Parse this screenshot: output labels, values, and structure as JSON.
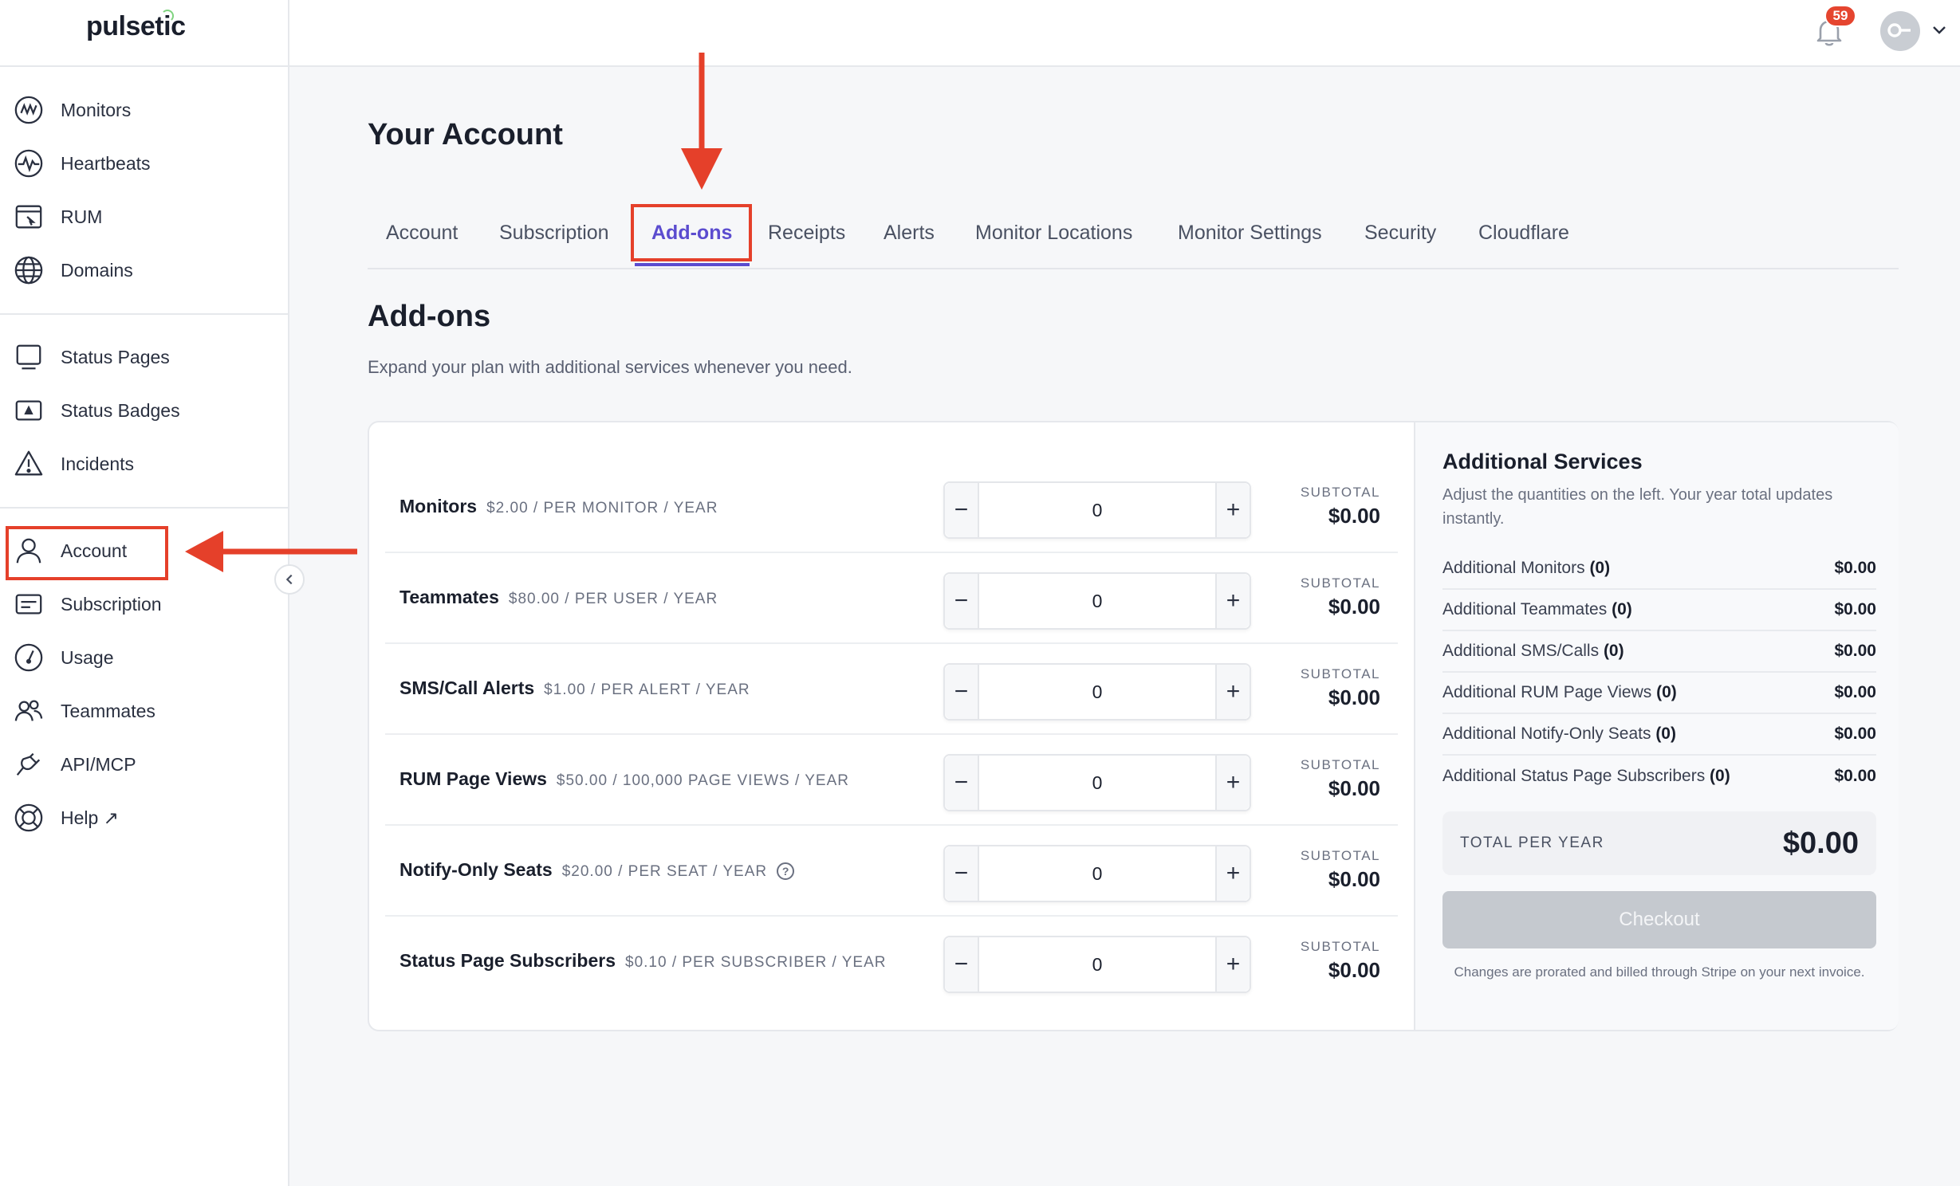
{
  "app": {
    "logo": "pulsetic"
  },
  "header": {
    "notification_count": "59"
  },
  "sidebar": {
    "groups": [
      [
        {
          "label": "Monitors",
          "icon": "monitors-icon"
        },
        {
          "label": "Heartbeats",
          "icon": "heartbeat-icon"
        },
        {
          "label": "RUM",
          "icon": "rum-icon"
        },
        {
          "label": "Domains",
          "icon": "globe-icon"
        }
      ],
      [
        {
          "label": "Status Pages",
          "icon": "status-pages-icon"
        },
        {
          "label": "Status Badges",
          "icon": "status-badges-icon"
        },
        {
          "label": "Incidents",
          "icon": "warning-icon"
        }
      ],
      [
        {
          "label": "Account",
          "icon": "user-icon"
        },
        {
          "label": "Subscription",
          "icon": "card-icon"
        },
        {
          "label": "Usage",
          "icon": "gauge-icon"
        },
        {
          "label": "Teammates",
          "icon": "users-icon"
        },
        {
          "label": "API/MCP",
          "icon": "plug-icon"
        },
        {
          "label": "Help ↗",
          "icon": "lifebuoy-icon"
        }
      ]
    ]
  },
  "page": {
    "title": "Your Account",
    "tabs": [
      "Account",
      "Subscription",
      "Add-ons",
      "Receipts",
      "Alerts",
      "Monitor Locations",
      "Monitor Settings",
      "Security",
      "Cloudflare"
    ],
    "active_tab": "Add-ons",
    "section_title": "Add-ons",
    "section_subtitle": "Expand your plan with additional services whenever you need."
  },
  "addons": [
    {
      "name": "Monitors",
      "price": "$2.00 / PER MONITOR / YEAR",
      "qty": "0",
      "subtotal_label": "SUBTOTAL",
      "subtotal": "$0.00"
    },
    {
      "name": "Teammates",
      "price": "$80.00 / PER USER / YEAR",
      "qty": "0",
      "subtotal_label": "SUBTOTAL",
      "subtotal": "$0.00"
    },
    {
      "name": "SMS/Call Alerts",
      "price": "$1.00 / PER ALERT / YEAR",
      "qty": "0",
      "subtotal_label": "SUBTOTAL",
      "subtotal": "$0.00"
    },
    {
      "name": "RUM Page Views",
      "price": "$50.00 / 100,000 PAGE VIEWS / YEAR",
      "qty": "0",
      "subtotal_label": "SUBTOTAL",
      "subtotal": "$0.00"
    },
    {
      "name": "Notify-Only Seats",
      "price": "$20.00 / PER SEAT / YEAR",
      "qty": "0",
      "subtotal_label": "SUBTOTAL",
      "subtotal": "$0.00",
      "help": "?"
    },
    {
      "name": "Status Page Subscribers",
      "price": "$0.10 / PER SUBSCRIBER / YEAR",
      "qty": "0",
      "subtotal_label": "SUBTOTAL",
      "subtotal": "$0.00"
    }
  ],
  "stepper": {
    "minus": "−",
    "plus": "+"
  },
  "summary": {
    "title": "Additional Services",
    "description": "Adjust the quantities on the left. Your year total updates instantly.",
    "rows": [
      {
        "label": "Additional Monitors",
        "count": "(0)",
        "amount": "$0.00"
      },
      {
        "label": "Additional Teammates",
        "count": "(0)",
        "amount": "$0.00"
      },
      {
        "label": "Additional SMS/Calls",
        "count": "(0)",
        "amount": "$0.00"
      },
      {
        "label": "Additional RUM Page Views",
        "count": "(0)",
        "amount": "$0.00"
      },
      {
        "label": "Additional Notify-Only Seats",
        "count": "(0)",
        "amount": "$0.00"
      },
      {
        "label": "Additional Status Page Subscribers",
        "count": "(0)",
        "amount": "$0.00"
      }
    ],
    "total_label": "TOTAL PER YEAR",
    "total_value": "$0.00",
    "checkout_label": "Checkout",
    "note": "Changes are prorated and billed through Stripe on your next invoice."
  },
  "colors": {
    "accent": "#5b4ccf",
    "annotation": "#e5402a",
    "badge": "#e5452f"
  }
}
